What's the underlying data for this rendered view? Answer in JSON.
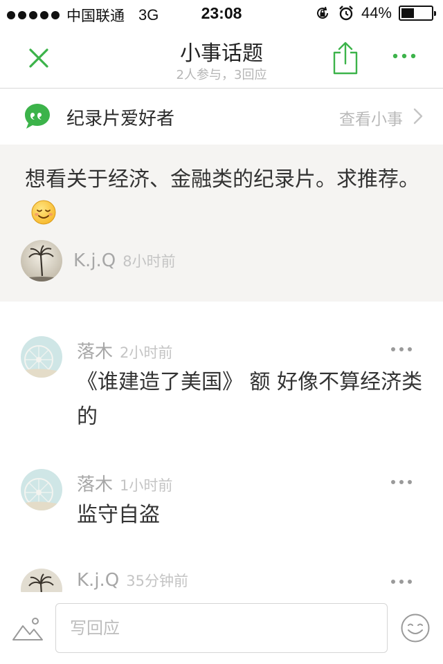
{
  "status_bar": {
    "carrier": "中国联通",
    "network": "3G",
    "time": "23:08",
    "battery": "44%",
    "battery_level": 0.44
  },
  "nav": {
    "title": "小事话题",
    "subtitle": "2人参与，3回应"
  },
  "topic": {
    "name": "纪录片爱好者",
    "link_label": "查看小事"
  },
  "post": {
    "text": "想看关于经济、金融类的纪录片。求推荐。",
    "author": "K.j.Q",
    "time": "8小时前"
  },
  "comments": [
    {
      "author": "落木",
      "time": "2小时前",
      "text": "《谁建造了美国》   额  好像不算经济类的"
    },
    {
      "author": "落木",
      "time": "1小时前",
      "text": "监守自盗"
    },
    {
      "author": "K.j.Q",
      "time": "35分钟前",
      "text": ""
    }
  ],
  "input": {
    "placeholder": "写回应"
  },
  "colors": {
    "accent_green": "#3cb34a",
    "muted_text": "#a7a7a7",
    "post_background": "#f5f4f2"
  },
  "icons": {
    "close": "close-icon",
    "share": "share-icon",
    "more": "more-icon",
    "topic": "quote-bubble-icon",
    "chevron": "chevron-right-icon",
    "photo": "photo-icon",
    "emoji": "emoji-icon"
  }
}
